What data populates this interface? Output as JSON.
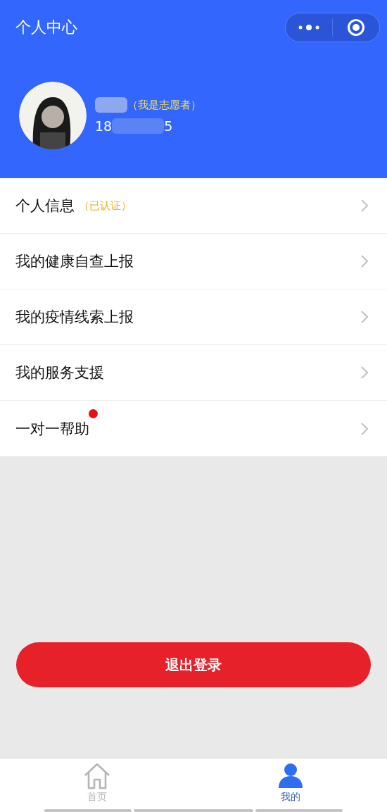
{
  "header": {
    "title": "个人中心"
  },
  "profile": {
    "role_badge": "（我是志愿者）",
    "phone_start": "18",
    "phone_end": "5"
  },
  "menu": [
    {
      "label": "个人信息",
      "status": "（已认证）",
      "dot": false
    },
    {
      "label": "我的健康自查上报",
      "dot": false
    },
    {
      "label": "我的疫情线索上报",
      "dot": false
    },
    {
      "label": "我的服务支援",
      "dot": false
    },
    {
      "label": "一对一帮助",
      "dot": true
    }
  ],
  "logout_button": "退出登录",
  "tab_bar": [
    {
      "label": "首页",
      "kind": "home",
      "selected": false
    },
    {
      "label": "我的",
      "kind": "person",
      "selected": true
    }
  ]
}
